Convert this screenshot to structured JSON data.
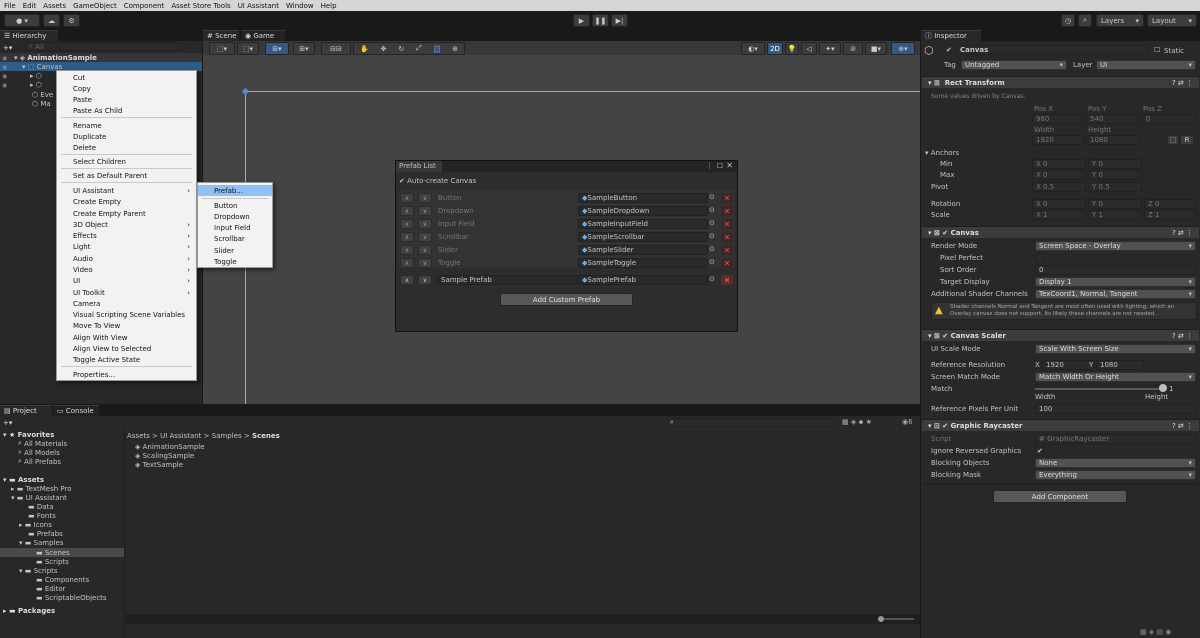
{
  "menubar": [
    "File",
    "Edit",
    "Assets",
    "GameObject",
    "Component",
    "Asset Store Tools",
    "UI Assistant",
    "Window",
    "Help"
  ],
  "toolbar": {
    "layers": "Layers",
    "layout": "Layout"
  },
  "hierarchy": {
    "tab": "Hierarchy",
    "search_placeholder": "All",
    "scene": "AnimationSample",
    "selected": "Canvas",
    "partial_rows": [
      "Eve",
      "Ma"
    ]
  },
  "context_menu": {
    "items": [
      "Cut",
      "Copy",
      "Paste",
      "Paste As Child",
      "Rename",
      "Duplicate",
      "Delete",
      "Select Children",
      "Set as Default Parent",
      "UI Assistant",
      "Create Empty",
      "Create Empty Parent",
      "3D Object",
      "Effects",
      "Light",
      "Audio",
      "Video",
      "UI",
      "UI Toolkit",
      "Camera",
      "Visual Scripting Scene Variables",
      "Move To View",
      "Align With View",
      "Align View to Selected",
      "Toggle Active State",
      "Properties..."
    ],
    "submenu_arrow": "›"
  },
  "ui_assistant_submenu": [
    "Prefab...",
    "Button",
    "Dropdown",
    "Input Field",
    "Scrollbar",
    "Slider",
    "Toggle"
  ],
  "scene_tabs": {
    "scene": "Scene",
    "game": "Game",
    "mode2d": "2D"
  },
  "prefab_list": {
    "title": "Prefab List",
    "auto_create": "Auto-create Canvas",
    "rows": [
      {
        "name": "Button",
        "prefab": "SampleButton"
      },
      {
        "name": "Dropdown",
        "prefab": "SampleDropdown"
      },
      {
        "name": "Input Field",
        "prefab": "SampleInputField"
      },
      {
        "name": "Scrollbar",
        "prefab": "SampleScrollbar"
      },
      {
        "name": "Slider",
        "prefab": "SampleSlider"
      },
      {
        "name": "Toggle",
        "prefab": "SampleToggle"
      }
    ],
    "custom_row": {
      "name": "Sample Prefab",
      "prefab": "SamplePrefab"
    },
    "add_button": "Add Custom Prefab"
  },
  "project": {
    "tabs": [
      "Project",
      "Console"
    ],
    "favorites": {
      "label": "Favorites",
      "items": [
        "All Materials",
        "All Models",
        "All Prefabs"
      ]
    },
    "assets": {
      "label": "Assets",
      "items": [
        "TextMesh Pro",
        "UI Assistant",
        "Data",
        "Fonts",
        "Icons",
        "Prefabs",
        "Samples",
        "Scenes",
        "Scripts",
        "Scripts",
        "Components",
        "Editor",
        "ScriptableObjects"
      ]
    },
    "packages": "Packages",
    "breadcrumb": [
      "Assets",
      "UI Assistant",
      "Samples",
      "Scenes"
    ],
    "files": [
      "AnimationSample",
      "ScalingSample",
      "TextSample"
    ],
    "count": "6"
  },
  "inspector": {
    "tab": "Inspector",
    "name": "Canvas",
    "static": "Static",
    "tag_label": "Tag",
    "tag": "Untagged",
    "layer_label": "Layer",
    "layer": "UI",
    "rect": {
      "title": "Rect Transform",
      "note": "Some values driven by Canvas.",
      "pos_labels": [
        "Pos X",
        "Pos Y",
        "Pos Z"
      ],
      "pos": [
        "960",
        "540",
        "0"
      ],
      "size_labels": [
        "Width",
        "Height"
      ],
      "size": [
        "1920",
        "1080"
      ],
      "anchors": "Anchors",
      "min": "Min",
      "max": "Max",
      "pivot": "Pivot",
      "rotation": "Rotation",
      "scale": "Scale",
      "min_x": "0",
      "min_y": "0",
      "max_x": "0",
      "max_y": "0",
      "pivot_x": "0.5",
      "pivot_y": "0.5",
      "rot": [
        "0",
        "0",
        "0"
      ],
      "scl": [
        "1",
        "1",
        "1"
      ],
      "r_btn": "R"
    },
    "canvas": {
      "title": "Canvas",
      "render_mode_label": "Render Mode",
      "render_mode": "Screen Space - Overlay",
      "pixel_perfect": "Pixel Perfect",
      "sort_order_label": "Sort Order",
      "sort_order": "0",
      "target_display_label": "Target Display",
      "target_display": "Display 1",
      "shader_label": "Additional Shader Channels",
      "shader": "TexCoord1, Normal, Tangent",
      "warning": "Shader channels Normal and Tangent are most often used with lighting, which an Overlay canvas does not support. Its likely these channels are not needed."
    },
    "scaler": {
      "title": "Canvas Scaler",
      "mode_label": "UI Scale Mode",
      "mode": "Scale With Screen Size",
      "ref_label": "Reference Resolution",
      "ref_x": "1920",
      "ref_y": "1080",
      "match_mode_label": "Screen Match Mode",
      "match_mode": "Match Width Or Height",
      "match_label": "Match",
      "match_value": "1",
      "match_level": 1,
      "width": "Width",
      "height": "Height",
      "ppu_label": "Reference Pixels Per Unit",
      "ppu": "100"
    },
    "raycaster": {
      "title": "Graphic Raycaster",
      "script_label": "Script",
      "script": "GraphicRaycaster",
      "ignore_label": "Ignore Reversed Graphics",
      "blocking_objects_label": "Blocking Objects",
      "blocking_objects": "None",
      "blocking_mask_label": "Blocking Mask",
      "blocking_mask": "Everything"
    },
    "add_component": "Add Component"
  }
}
